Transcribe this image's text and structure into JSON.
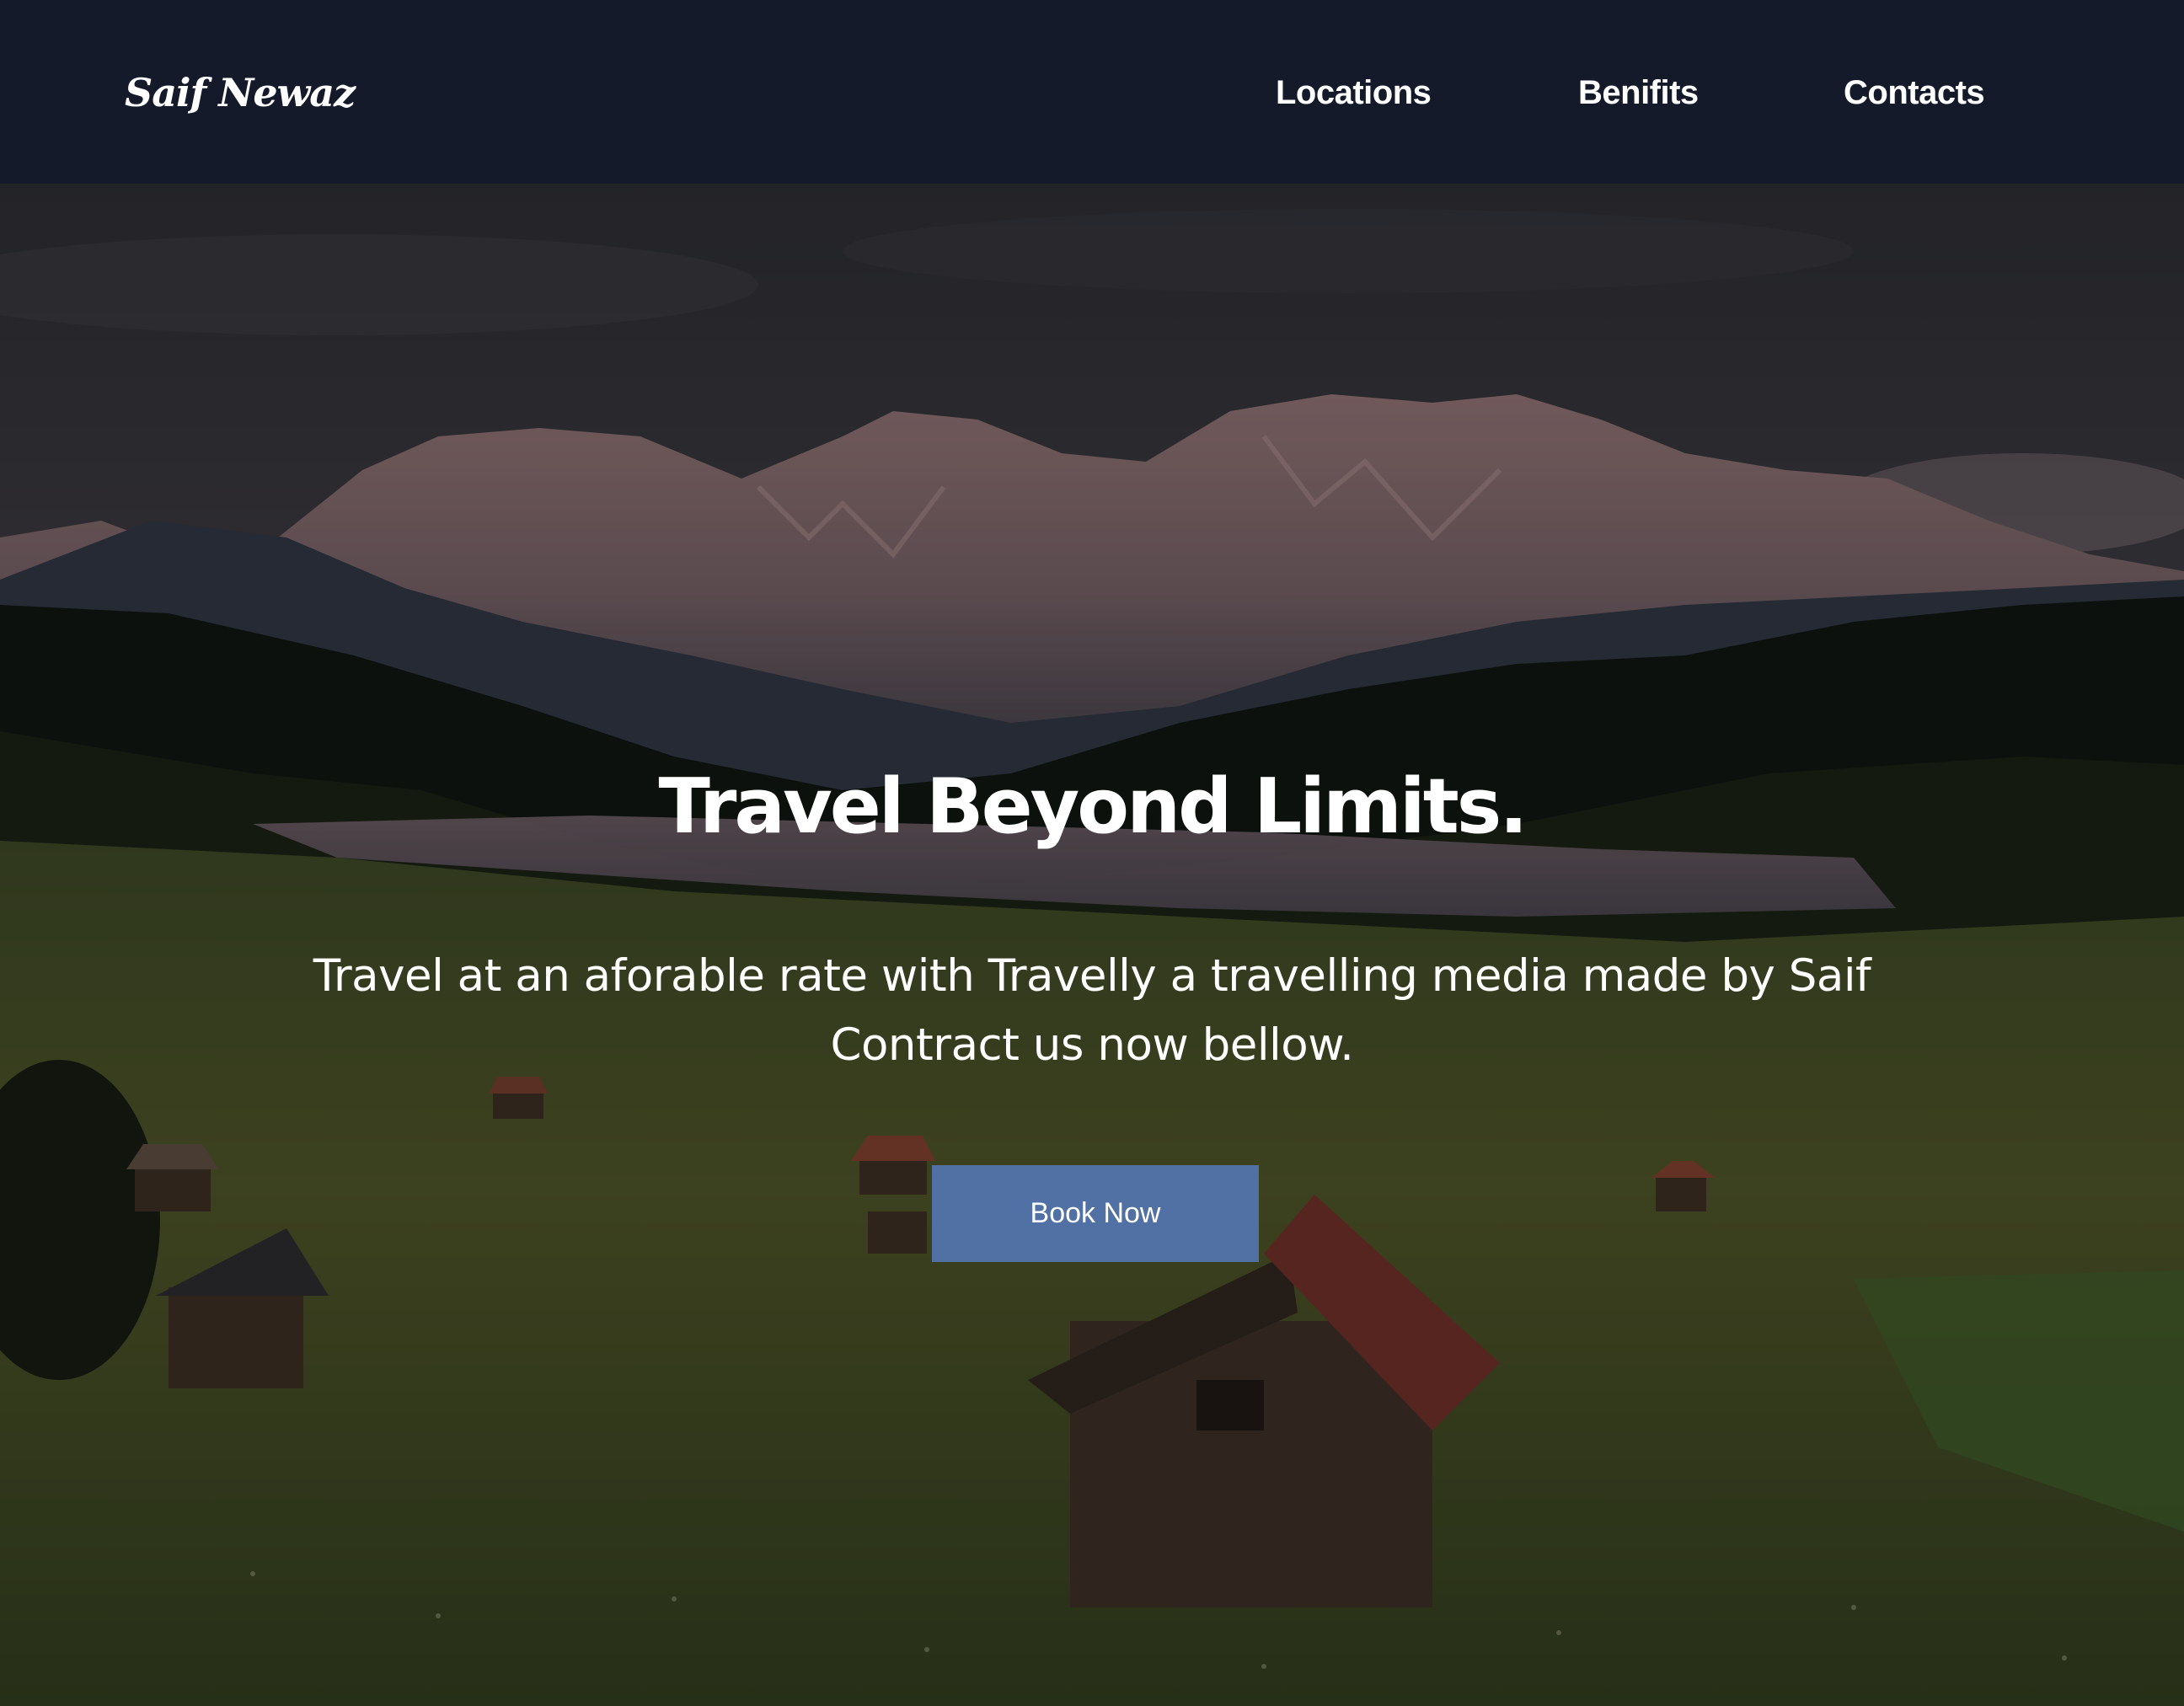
{
  "navbar": {
    "brand": "Saif Newaz",
    "links": [
      {
        "label": "Locations"
      },
      {
        "label": "Benifits"
      },
      {
        "label": "Contacts"
      }
    ]
  },
  "hero": {
    "title": "Travel Beyond Limits.",
    "subtitle": "Travel at an aforable rate with Travelly a travelling media made by Saif Contract us now bellow.",
    "cta_label": "Book Now"
  },
  "colors": {
    "navbar_bg": "#141a2a",
    "button_bg": "#5171a5",
    "text": "#ffffff"
  }
}
